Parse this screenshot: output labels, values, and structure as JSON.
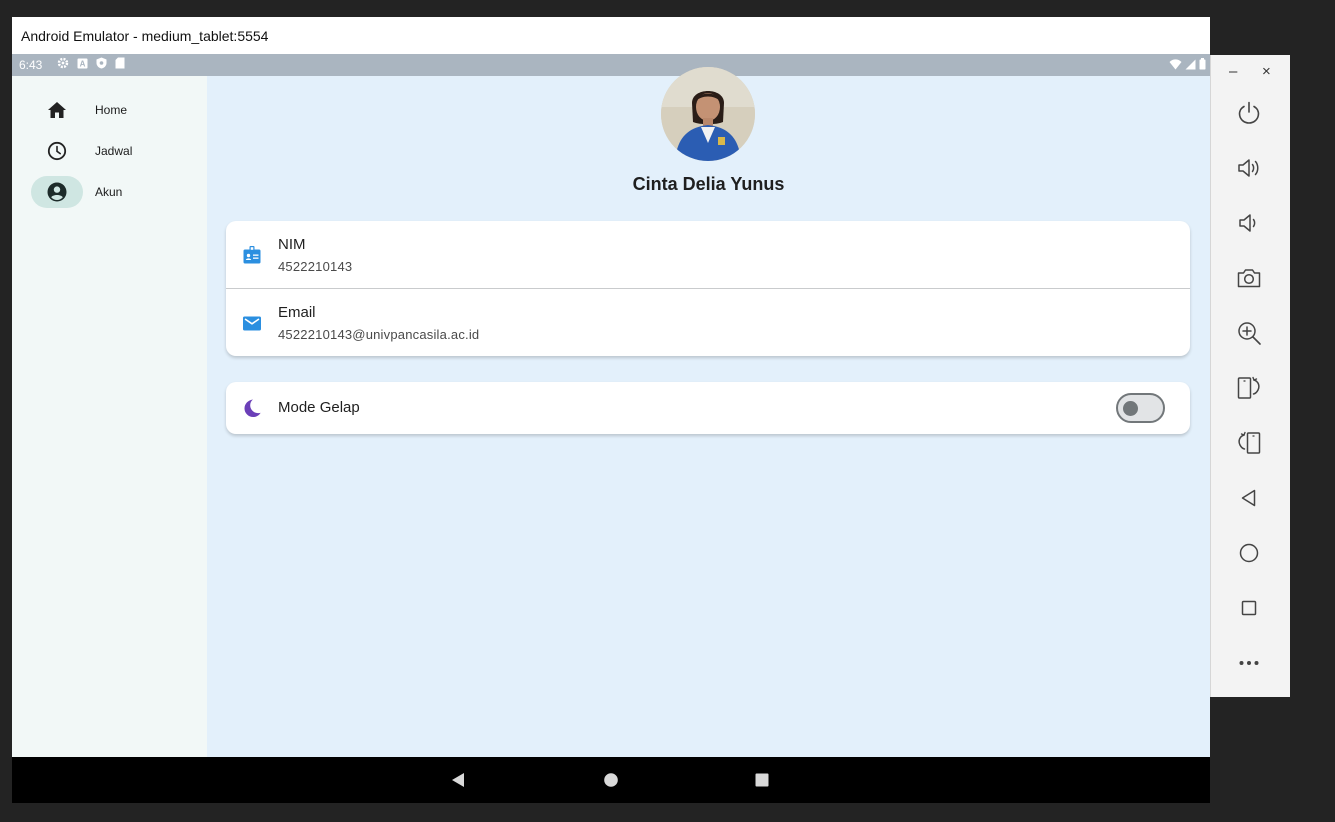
{
  "window": {
    "title": "Android Emulator - medium_tablet:5554"
  },
  "status_bar": {
    "time": "6:43"
  },
  "nav_rail": {
    "items": [
      {
        "label": "Home",
        "icon": "home-icon",
        "active": false
      },
      {
        "label": "Jadwal",
        "icon": "clock-icon",
        "active": false
      },
      {
        "label": "Akun",
        "icon": "account-circle-icon",
        "active": true
      }
    ]
  },
  "profile": {
    "name": "Cinta Delia Yunus",
    "avatar": "profile-photo"
  },
  "info_card": {
    "nim": {
      "title": "NIM",
      "value": "4522210143",
      "icon": "badge-icon"
    },
    "email": {
      "title": "Email",
      "value": "4522210143@univpancasila.ac.id",
      "icon": "mail-icon"
    }
  },
  "dark_mode": {
    "label": "Mode Gelap",
    "icon": "moon-icon",
    "enabled": false
  },
  "toolbar": {
    "minimize": "–",
    "close": "×",
    "buttons": [
      "power-icon",
      "volume-up-icon",
      "volume-down-icon",
      "camera-icon",
      "zoom-in-icon",
      "rotate-left-icon",
      "rotate-right-icon",
      "back-icon",
      "home-icon",
      "overview-icon",
      "more-icon"
    ]
  },
  "colors": {
    "accent_blue": "#2b8fe0",
    "moon_purple": "#6b3fb8",
    "rail_active": "#cfe6e2",
    "screen_bg": "#e3f0fb"
  }
}
